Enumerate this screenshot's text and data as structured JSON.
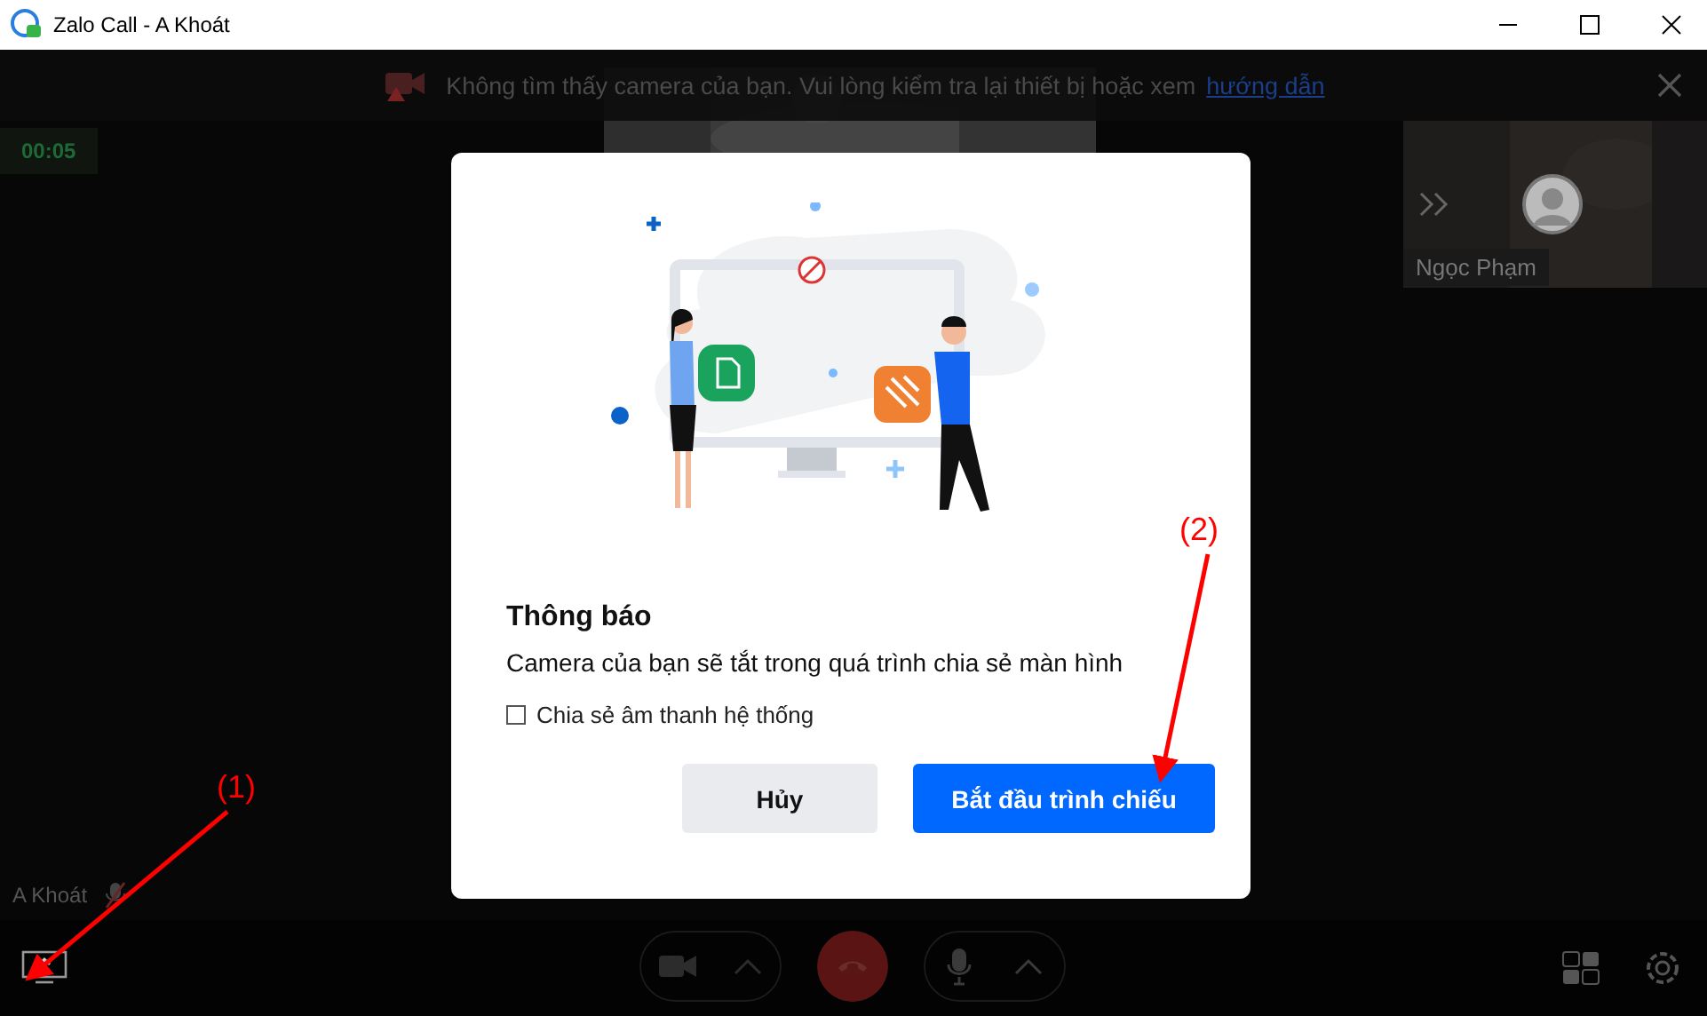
{
  "window": {
    "title": "Zalo Call - A Khoát"
  },
  "banner": {
    "text": "Không tìm thấy camera của bạn. Vui lòng kiểm tra lại thiết bị hoặc xem",
    "link": "hướng dẫn"
  },
  "timer": "00:05",
  "participant_thumbnail": {
    "name": "Ngọc Phạm"
  },
  "self_label": {
    "name": "A Khoát",
    "muted": true
  },
  "dialog": {
    "title": "Thông báo",
    "message": "Camera của bạn sẽ tắt trong quá trình chia sẻ màn hình",
    "checkbox": {
      "label": "Chia sẻ âm thanh hệ thống",
      "checked": false
    },
    "buttons": [
      {
        "label": "Hủy",
        "kind": "secondary"
      },
      {
        "label": "Bắt đầu trình chiếu",
        "kind": "primary"
      }
    ]
  },
  "annotations": [
    {
      "label": "(1)"
    },
    {
      "label": "(2)"
    }
  ]
}
